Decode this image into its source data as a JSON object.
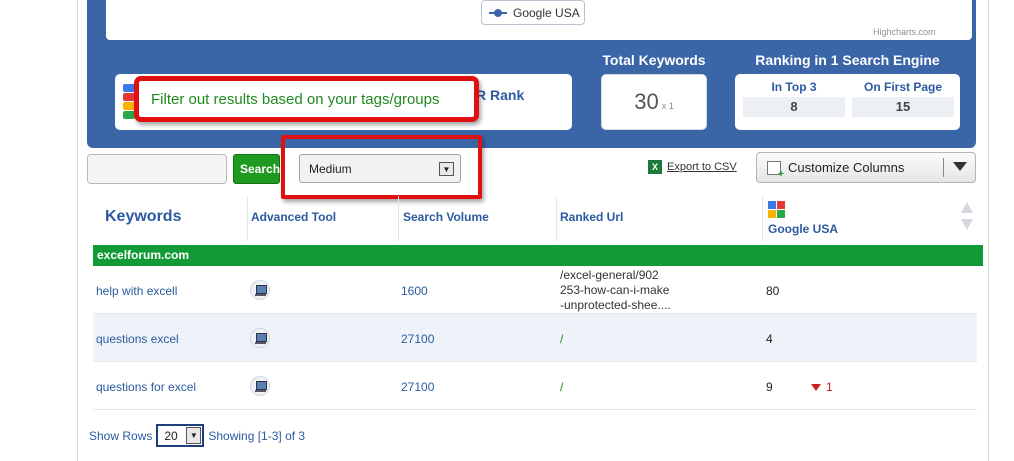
{
  "chart": {
    "legend_label": "Google USA",
    "credit": "Highcharts.com"
  },
  "summary": {
    "rank_label": "R Rank",
    "total_keywords_title": "Total Keywords",
    "total_keywords_value": "30",
    "total_keywords_multiplier": "x 1",
    "ranking_title": "Ranking in 1 Search Engine",
    "top3_label": "In Top 3",
    "top3_value": "8",
    "first_page_label": "On First Page",
    "first_page_value": "15"
  },
  "tooltip": {
    "text": "Filter out results based on your tags/groups"
  },
  "toolbar": {
    "search_value": "",
    "search_button": "Search",
    "filter_selected": "Medium",
    "export_label": "Export to CSV",
    "customize_label": "Customize Columns"
  },
  "table": {
    "headers": {
      "keywords": "Keywords",
      "advanced_tool": "Advanced Tool",
      "search_volume": "Search Volume",
      "ranked_url": "Ranked Url",
      "engine": "Google USA"
    },
    "group": "excelforum.com",
    "rows": [
      {
        "keyword": "help with excell",
        "volume": "1600",
        "url_lines": [
          "/excel-general/902",
          "253-how-can-i-make",
          "-unprotected-shee...."
        ],
        "rank": "80",
        "change": ""
      },
      {
        "keyword": "questions excel",
        "volume": "27100",
        "url": "/",
        "rank": "4",
        "change": ""
      },
      {
        "keyword": "questions for excel",
        "volume": "27100",
        "url": "/",
        "rank": "9",
        "change": "1"
      }
    ]
  },
  "footer": {
    "show_rows_label": "Show Rows",
    "rows_value": "20",
    "showing_text": "Showing [1-3] of 3"
  },
  "colors": {
    "panel_blue": "#3a66a8",
    "group_green": "#119a35",
    "highlight_red": "#e01010",
    "link_blue": "#2c5aa0",
    "negative_red": "#c62020"
  }
}
